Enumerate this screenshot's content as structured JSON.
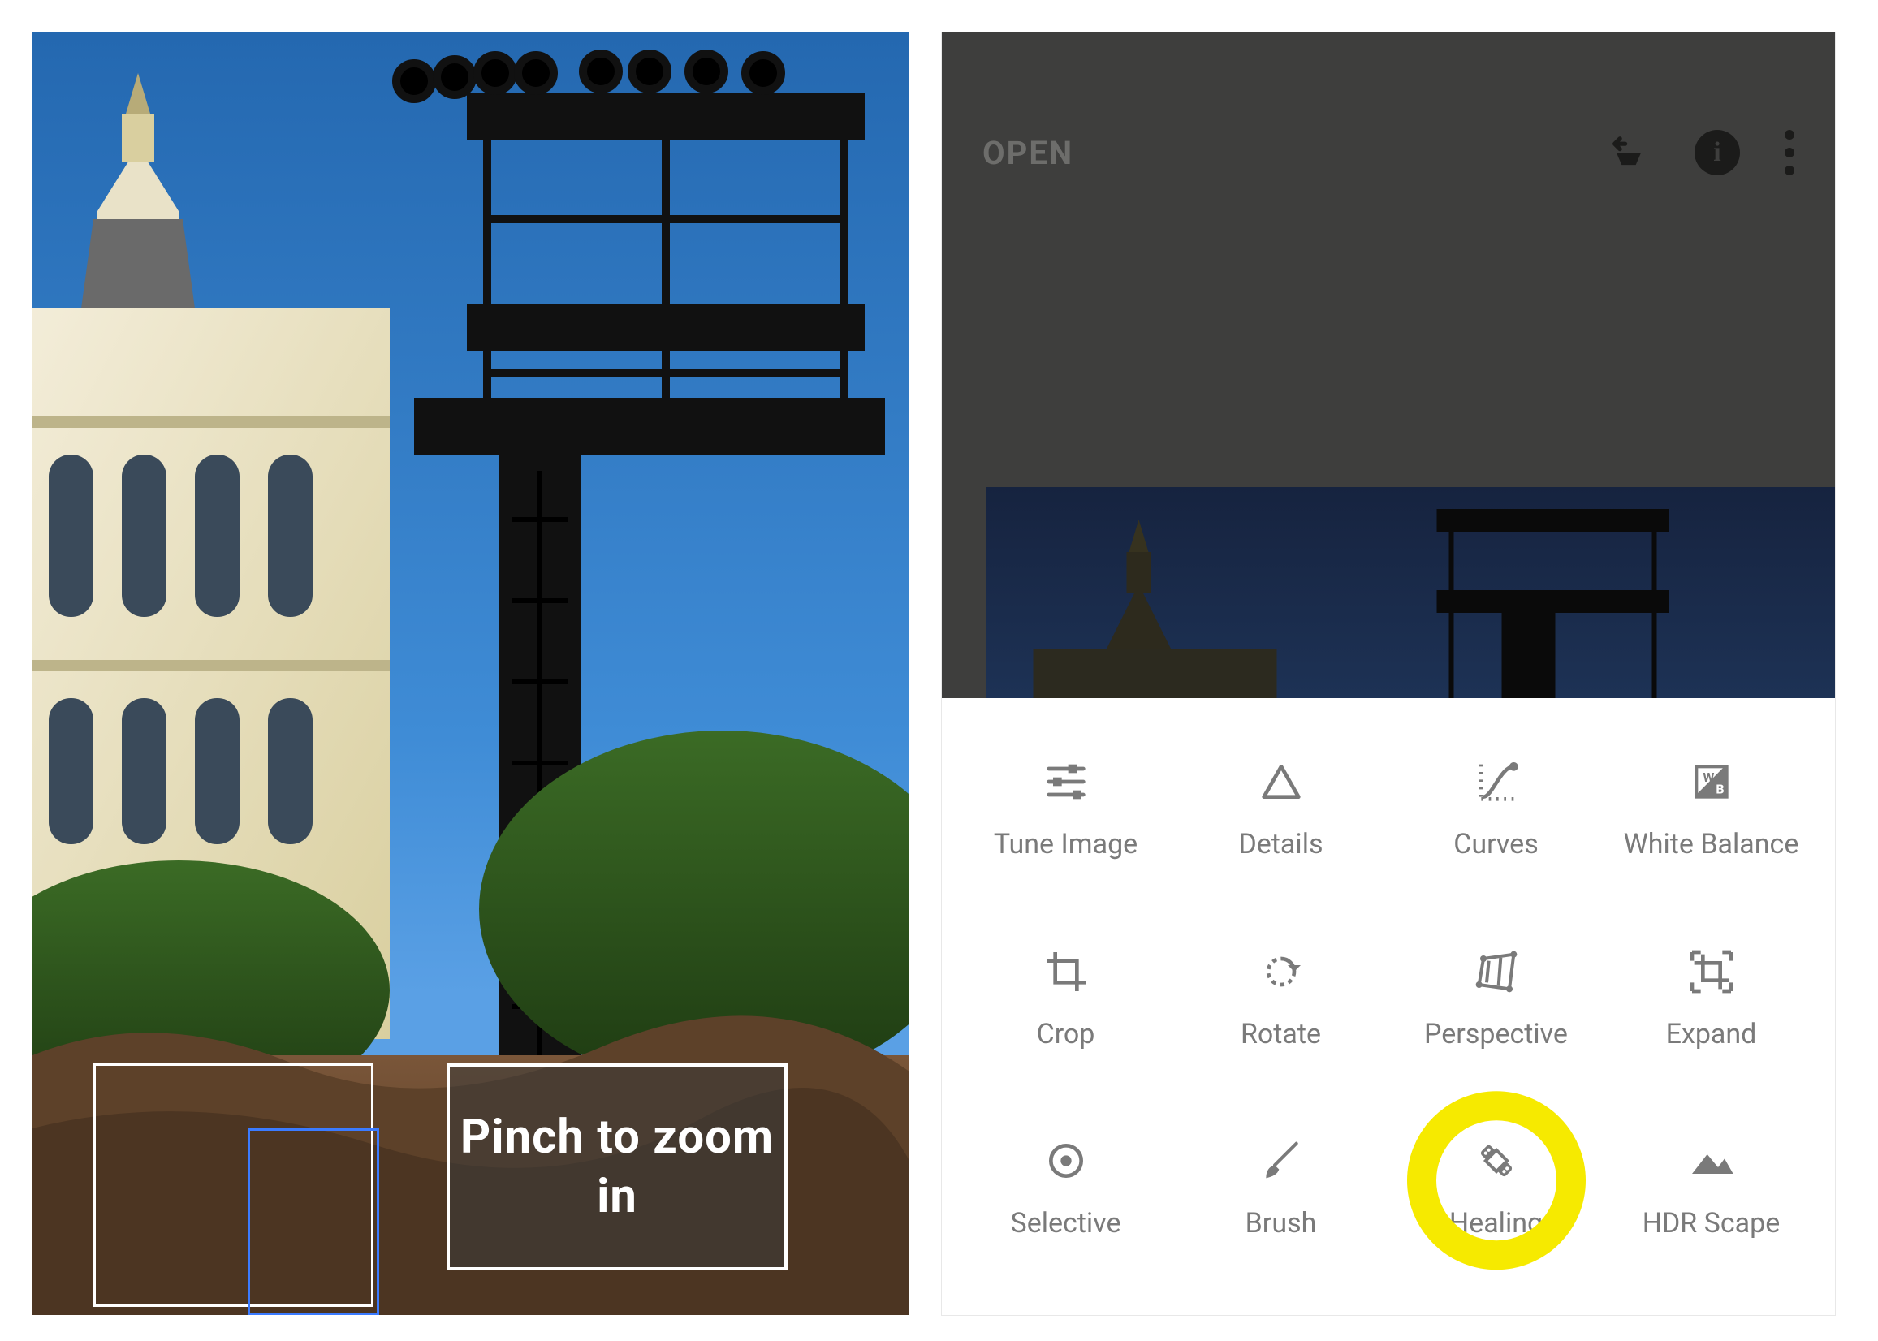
{
  "left": {
    "hint_text": "Pinch to zoom in"
  },
  "right": {
    "header": {
      "open_label": "OPEN"
    },
    "tools": [
      {
        "id": "tune-image",
        "label": "Tune Image"
      },
      {
        "id": "details",
        "label": "Details"
      },
      {
        "id": "curves",
        "label": "Curves"
      },
      {
        "id": "white-bal",
        "label": "White Balance"
      },
      {
        "id": "crop",
        "label": "Crop"
      },
      {
        "id": "rotate",
        "label": "Rotate"
      },
      {
        "id": "perspective",
        "label": "Perspective"
      },
      {
        "id": "expand",
        "label": "Expand"
      },
      {
        "id": "selective",
        "label": "Selective"
      },
      {
        "id": "brush",
        "label": "Brush"
      },
      {
        "id": "healing",
        "label": "Healing"
      },
      {
        "id": "hdr-scape",
        "label": "HDR Scape"
      }
    ],
    "highlighted_tool_index": 10
  }
}
